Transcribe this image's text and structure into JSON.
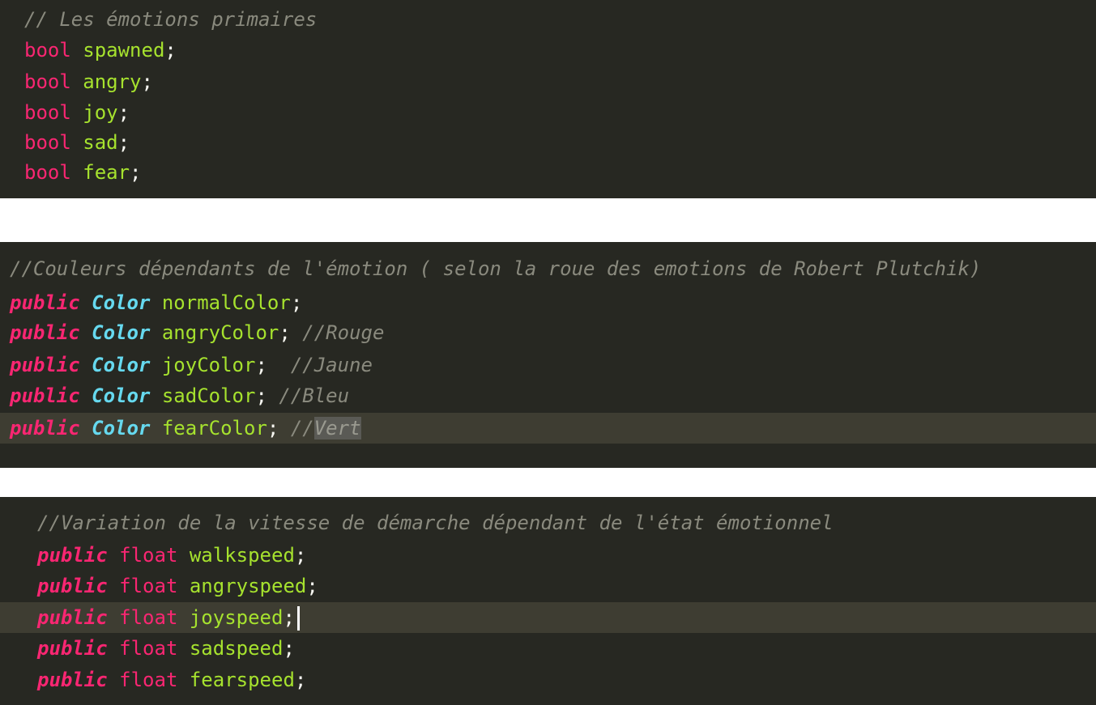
{
  "colors": {
    "background": "#272822",
    "comment": "#8a8a7e",
    "keyword": "#f92672",
    "class_name": "#66d9ef",
    "identifier": "#a6e22e",
    "current_line": "#3e3d32"
  },
  "block1": {
    "comment": "// Les émotions primaires",
    "lines": [
      {
        "type": "bool",
        "name": "spawned",
        "punct": ";"
      },
      {
        "type": "bool",
        "name": "angry",
        "punct": ";"
      },
      {
        "type": "bool",
        "name": "joy",
        "punct": ";"
      },
      {
        "type": "bool",
        "name": "sad",
        "punct": ";"
      },
      {
        "type": "bool",
        "name": "fear",
        "punct": ";"
      }
    ]
  },
  "block2": {
    "comment": "//Couleurs dépendants de l'émotion ( selon la roue des emotions de Robert Plutchik)",
    "lines": [
      {
        "kw": "public",
        "cls": "Color",
        "name": "normalColor",
        "punct": ";",
        "comment": ""
      },
      {
        "kw": "public",
        "cls": "Color",
        "name": "angryColor",
        "punct": "; ",
        "comment": "//Rouge"
      },
      {
        "kw": "public",
        "cls": "Color",
        "name": "joyColor",
        "punct": ";  ",
        "comment": "//Jaune"
      },
      {
        "kw": "public",
        "cls": "Color",
        "name": "sadColor",
        "punct": "; ",
        "comment": "//Bleu"
      },
      {
        "kw": "public",
        "cls": "Color",
        "name": "fearColor",
        "punct": "; ",
        "comment": "//",
        "selected": "Vert"
      }
    ]
  },
  "block3": {
    "comment": "//Variation de la vitesse de démarche dépendant de l'état émotionnel",
    "lines": [
      {
        "kw": "public",
        "type": "float",
        "name": "walkspeed",
        "punct": ";"
      },
      {
        "kw": "public",
        "type": "float",
        "name": "angryspeed",
        "punct": ";"
      },
      {
        "kw": "public",
        "type": "float",
        "name": "joyspeed",
        "punct": ";"
      },
      {
        "kw": "public",
        "type": "float",
        "name": "sadspeed",
        "punct": ";"
      },
      {
        "kw": "public",
        "type": "float",
        "name": "fearspeed",
        "punct": ";"
      }
    ]
  }
}
